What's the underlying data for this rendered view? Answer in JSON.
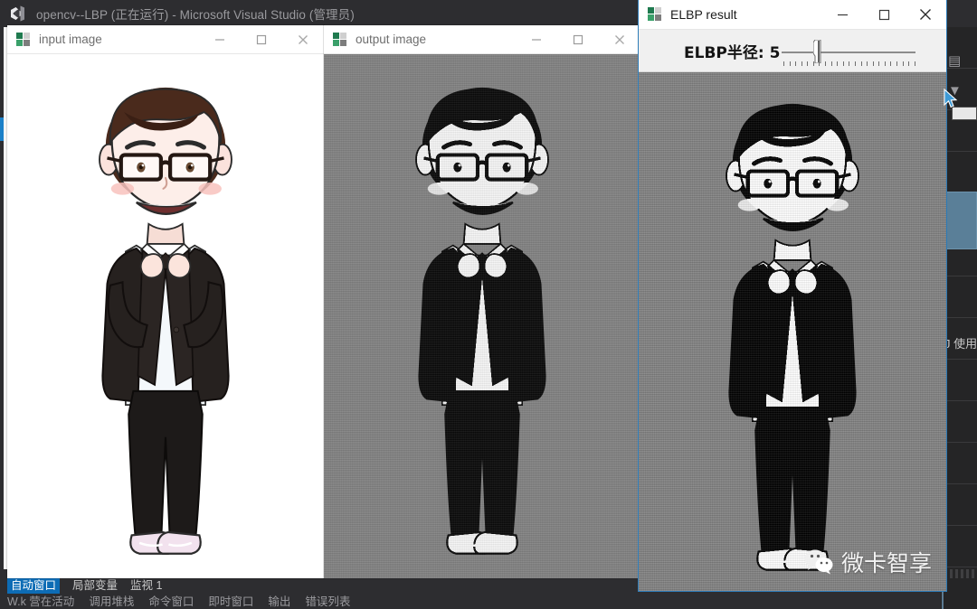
{
  "ide": {
    "title": "opencv--LBP (正在运行) - Microsoft Visual Studio (管理员)",
    "logo_icon": "visual-studio-icon",
    "right_panel_text": "J 使用",
    "bottom_tabs": [
      {
        "label": "自动窗口",
        "active": true
      },
      {
        "label": "局部变量",
        "active": false
      },
      {
        "label": "监视 1",
        "active": false
      }
    ],
    "bottom_tabs_secondary": [
      {
        "label": "W.k 营在活动"
      },
      {
        "label": "调用堆栈"
      },
      {
        "label": "命令窗口"
      },
      {
        "label": "即时窗口"
      },
      {
        "label": "输出"
      },
      {
        "label": "错误列表"
      }
    ]
  },
  "windows": {
    "input": {
      "title": "input image",
      "icon": "opencv-window-icon",
      "minimize_label": "—",
      "maximize_label": "□",
      "close_label": "✕",
      "body_background": "#ffffff",
      "image_alt": "cartoon-avatar-color"
    },
    "output": {
      "title": "output image",
      "icon": "opencv-window-icon",
      "minimize_label": "—",
      "maximize_label": "□",
      "close_label": "✕",
      "body_background": "#828282",
      "image_alt": "cartoon-avatar-lbp"
    },
    "elbp": {
      "title": "ELBP result",
      "icon": "opencv-window-icon",
      "minimize_label": "—",
      "maximize_label": "□",
      "close_label": "✕",
      "body_background": "#828282",
      "image_alt": "cartoon-avatar-elbp",
      "trackbar": {
        "label": "ELBP半径: 5",
        "name": "ELBP半径",
        "value": 5,
        "min": 0,
        "max": 22,
        "tick_count": 23
      }
    }
  },
  "watermark": {
    "icon": "wechat-icon",
    "text": "微卡智享"
  },
  "colors": {
    "ide_background": "#2d2d30",
    "ide_title_text": "#9a9a9e",
    "accent_blue": "#0d6cb5",
    "window_chrome": "#ffffff",
    "trackbar_panel": "#f0f0f0",
    "image_gray": "#828282",
    "panel_selection": "#5a7f98"
  }
}
